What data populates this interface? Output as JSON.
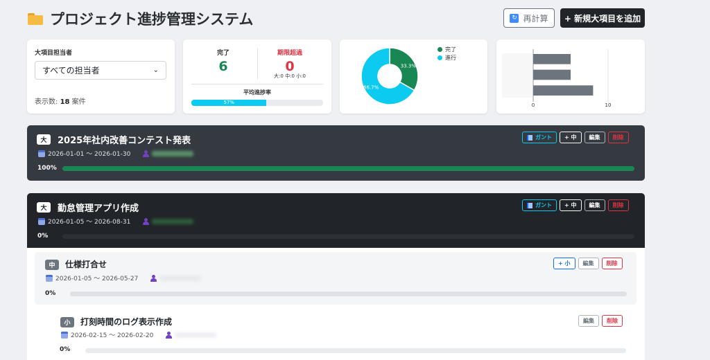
{
  "header": {
    "title": "プロジェクト進捗管理システム",
    "recalc_label": "再計算",
    "add_label": "+ 新規大項目を追加"
  },
  "filter": {
    "label": "大項目担当者",
    "selected": "すべての担当者",
    "count_prefix": "表示数: ",
    "count": "18",
    "count_suffix": " 案件"
  },
  "stats": {
    "done_label": "完了",
    "done_value": "6",
    "overdue_label": "期限超過",
    "overdue_value": "0",
    "overdue_breakdown": "大:0 中:0 小:0",
    "avg_label": "平均進捗率",
    "avg_value": "57%",
    "avg_fraction": 0.57
  },
  "chart_data": [
    {
      "type": "pie",
      "categories": [
        "完了",
        "進行"
      ],
      "values": [
        33.3,
        66.7
      ],
      "labels": [
        "33.3%",
        "66.7%"
      ],
      "colors": [
        "#198754",
        "#0dcaf0"
      ],
      "legend": "top-right"
    },
    {
      "type": "bar",
      "orientation": "horizontal",
      "categories": [
        "",
        "",
        ""
      ],
      "values": [
        5,
        5,
        8
      ],
      "xlim": [
        0,
        10
      ],
      "xticks": [
        "0",
        "10"
      ],
      "color": "#6c757d"
    }
  ],
  "projects": [
    {
      "level": "大",
      "title": "2025年社内改善コンテスト発表",
      "dates": "2026-01-01 〜 2026-01-30",
      "progress_label": "100%",
      "progress": 1.0
    },
    {
      "level": "大",
      "title": "勤怠管理アプリ作成",
      "dates": "2026-01-05 〜 2026-08-31",
      "progress_label": "0%",
      "progress": 0.0
    }
  ],
  "middle": {
    "level": "中",
    "title": "仕様打合せ",
    "dates": "2026-01-05 〜 2026-05-27",
    "progress_label": "0%",
    "progress": 0.0
  },
  "small": {
    "level": "小",
    "title": "打刻時間のログ表示作成",
    "dates": "2026-02-15 〜 2026-02-20",
    "progress_label": "0%",
    "progress": 0.0
  },
  "buttons": {
    "gantt": "ガント",
    "add_mid": "+ 中",
    "add_small": "+ 小",
    "edit": "編集",
    "delete": "削除"
  },
  "colors": {
    "success": "#198754",
    "info": "#0dcaf0",
    "danger": "#dc3545",
    "primary": "#0d6efd"
  }
}
